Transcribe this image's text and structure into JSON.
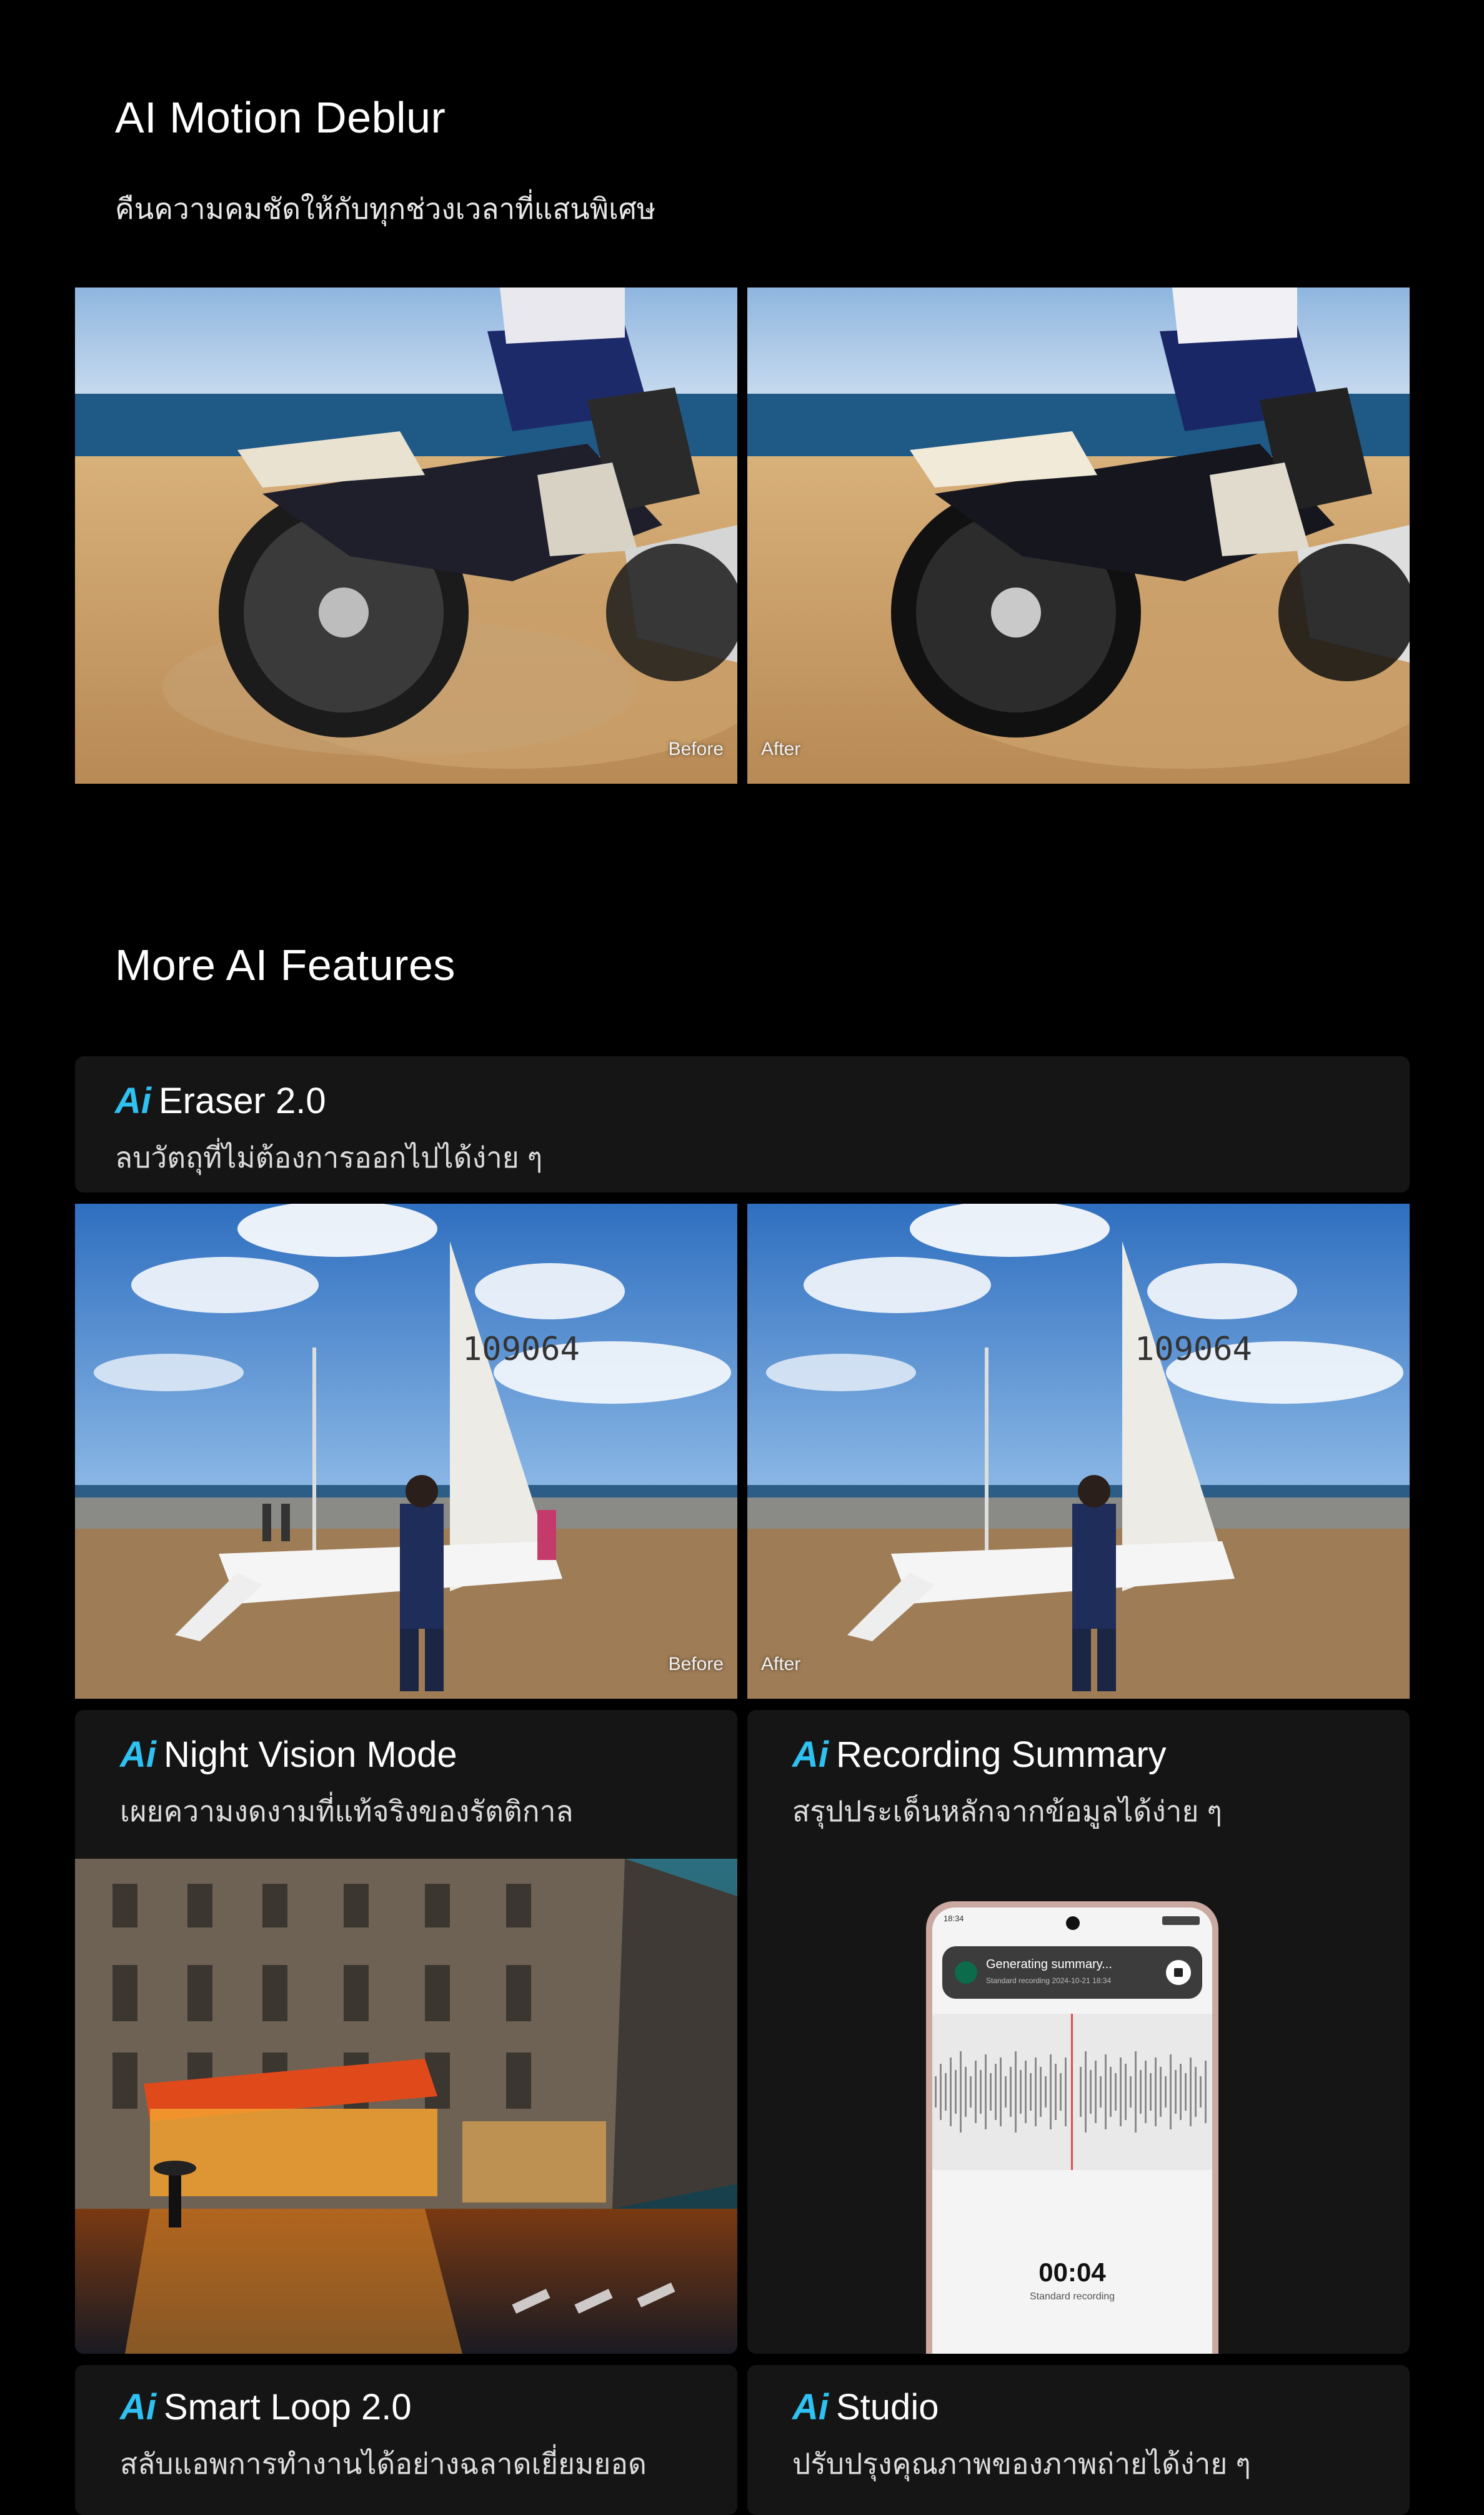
{
  "motion": {
    "title": "AI Motion Deblur",
    "subtitle": "คืนความคมชัดให้กับทุกช่วงเวลาที่แสนพิเศษ",
    "before_label": "Before",
    "after_label": "After"
  },
  "more": {
    "title": "More AI Features"
  },
  "features": {
    "ai_badge": "Ai",
    "eraser": {
      "title": "Eraser 2.0",
      "desc": "ลบวัตถุที่ไม่ต้องการออกไปได้ง่าย ๆ",
      "before_label": "Before",
      "after_label": "After",
      "sail_number": "109064"
    },
    "night": {
      "title": "Night Vision Mode",
      "desc": "เผยความงดงามที่แท้จริงของรัตติกาล"
    },
    "recording": {
      "title": "Recording Summary",
      "desc": "สรุปประเด็นหลักจากข้อมูลได้ง่าย ๆ",
      "phone": {
        "status_time": "18:34",
        "banner_title": "Generating summary...",
        "banner_sub": "Standard recording  2024-10-21 18:34",
        "timer": "00:04",
        "timer_label": "Standard recording"
      }
    },
    "smartloop": {
      "title": "Smart Loop 2.0",
      "desc": "สลับแอพการทำงานได้อย่างฉลาดเยี่ยมยอด"
    },
    "studio": {
      "title": "Studio",
      "desc": "ปรับปรุงคุณภาพของภาพถ่ายได้ง่าย ๆ"
    }
  },
  "colors": {
    "background": "#000000",
    "card": "#151515",
    "ai_accent": "#2ec1f2"
  }
}
